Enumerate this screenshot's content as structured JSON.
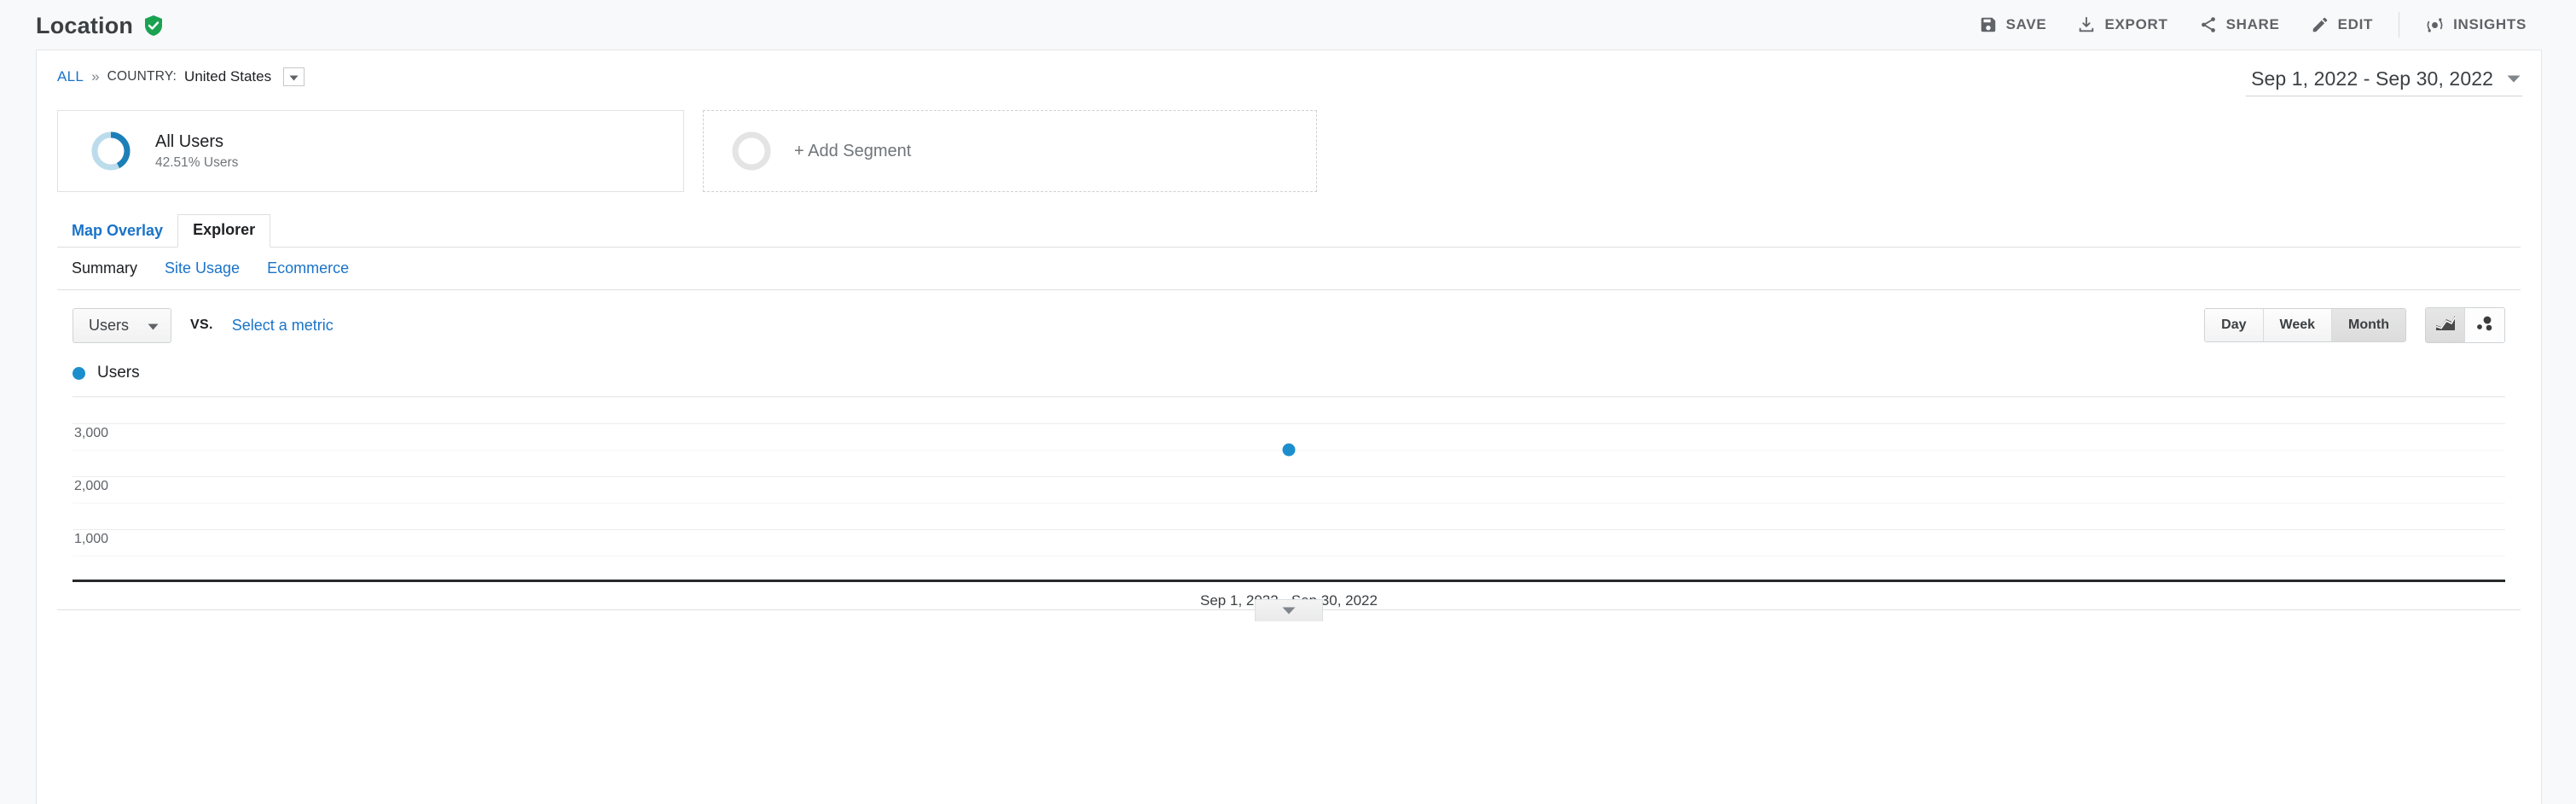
{
  "header": {
    "title": "Location",
    "verified_icon": "verified-shield-icon",
    "actions": [
      {
        "label": "SAVE",
        "icon": "save-icon"
      },
      {
        "label": "EXPORT",
        "icon": "export-icon"
      },
      {
        "label": "SHARE",
        "icon": "share-icon"
      },
      {
        "label": "EDIT",
        "icon": "edit-pencil-icon"
      },
      {
        "label": "INSIGHTS",
        "icon": "insights-icon"
      }
    ]
  },
  "breadcrumb": {
    "all_label": "ALL",
    "separator": "»",
    "dimension_key": "COUNTRY:",
    "dimension_value": "United States",
    "caret_icon": "chevron-down-icon"
  },
  "date_range": {
    "value": "Sep 1, 2022 - Sep 30, 2022",
    "caret_icon": "chevron-down-icon"
  },
  "segments": [
    {
      "name": "All Users",
      "sublabel": "42.51% Users",
      "percent": 42.51,
      "donut_color": "#1d7fb8",
      "donut_track_color": "#bcdcec"
    },
    {
      "add_label": "+ Add Segment",
      "ring_color": "#e4e4e4"
    }
  ],
  "tabs": [
    {
      "label": "Map Overlay",
      "active": false
    },
    {
      "label": "Explorer",
      "active": true
    }
  ],
  "subtabs": [
    {
      "label": "Summary",
      "active": true
    },
    {
      "label": "Site Usage",
      "active": false
    },
    {
      "label": "Ecommerce",
      "active": false
    }
  ],
  "metric_controls": {
    "primary_metric": "Users",
    "vs_label": "VS.",
    "secondary_metric_link": "Select a metric",
    "granularity": [
      {
        "label": "Day",
        "selected": false
      },
      {
        "label": "Week",
        "selected": false
      },
      {
        "label": "Month",
        "selected": true
      }
    ],
    "chart_types": [
      {
        "icon": "line-chart-icon",
        "selected": true
      },
      {
        "icon": "motion-chart-icon",
        "selected": false
      }
    ]
  },
  "chart_data": {
    "type": "line",
    "title": "",
    "xlabel": "Sep 1, 2022 - Sep 30, 2022",
    "ylabel": "",
    "legend": [
      {
        "name": "Users",
        "color": "#1d8ecd"
      }
    ],
    "legend_position": "top-left",
    "grid": true,
    "ylim": [
      0,
      3500
    ],
    "yticks": [
      1000,
      2000,
      3000
    ],
    "ytick_labels": [
      "1,000",
      "2,000",
      "3,000"
    ],
    "minor_gridlines": [
      500,
      1500,
      2500,
      3500
    ],
    "x": [
      "Sep 2022"
    ],
    "series": [
      {
        "name": "Users",
        "values": [
          2500
        ]
      }
    ],
    "x_axis_caption": "Sep 1, 2022 - Sep 30, 2022"
  },
  "collapse_handle": {
    "icon": "chevron-down-icon"
  }
}
